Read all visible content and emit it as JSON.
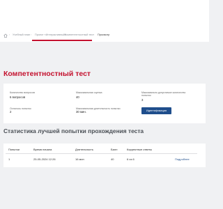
{
  "breadcrumbs": {
    "items": [
      "Учебный план",
      "Проект «Интерактивный»",
      "Компетентностный тест",
      "Просмотр"
    ]
  },
  "page": {
    "title": "Компетентностный тест"
  },
  "test_info": {
    "questions_label": "Количество вопросов",
    "questions_value": "6 вопросов",
    "max_score_label": "Максимальная оценка",
    "max_score_value": "40",
    "max_attempts_label": "Максимально допустимое количество попыток",
    "max_attempts_value": "3",
    "attempts_left_label": "Осталось попыток",
    "attempts_left_value": "2",
    "max_duration_label": "Максимальная длительность попытки",
    "max_duration_value": "30 мин.",
    "identify_button": "Идентификация"
  },
  "stats": {
    "title": "Статистика лучшей попытки прохождения теста",
    "columns": [
      "Попытки",
      "Время начала",
      "Длительность",
      "Балл",
      "Корректные ответы"
    ],
    "rows": [
      {
        "attempt": "1",
        "start_time": "25-05-2024 12:26",
        "duration": "16 мин",
        "score": "40",
        "correct": "6 из 6",
        "details_link": "Подробнее"
      }
    ]
  },
  "colors": {
    "accent": "#c4122f",
    "button": "#1f4e8c",
    "background": "#f0f1f3"
  }
}
